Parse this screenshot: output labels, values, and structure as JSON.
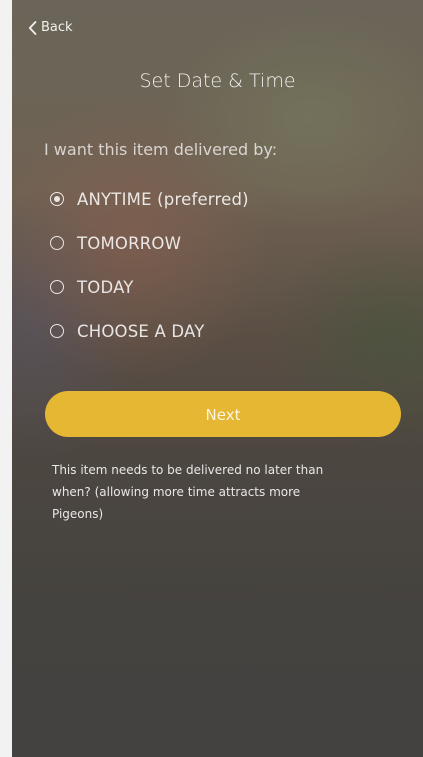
{
  "nav": {
    "back_label": "Back"
  },
  "header": {
    "title": "Set Date & Time"
  },
  "form": {
    "prompt": "I want this item delivered by:",
    "selected": 0,
    "options": [
      {
        "label": "ANYTIME (preferred)"
      },
      {
        "label": "TOMORROW"
      },
      {
        "label": "TODAY"
      },
      {
        "label": "CHOOSE A DAY"
      }
    ]
  },
  "actions": {
    "next_label": "Next"
  },
  "helper": {
    "text": "This item needs to be delivered no later than when? (allowing more time attracts more Pigeons)"
  },
  "colors": {
    "accent": "#e6b733"
  }
}
